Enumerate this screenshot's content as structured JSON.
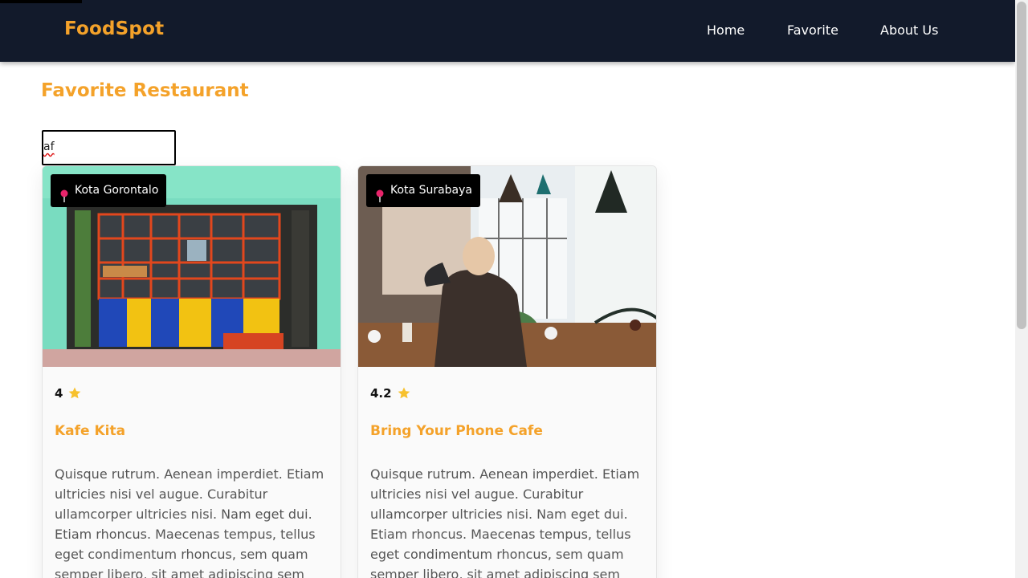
{
  "app": {
    "brand": "FoodSpot"
  },
  "nav": {
    "items": [
      "Home",
      "Favorite",
      "About Us"
    ]
  },
  "page": {
    "title": "Favorite Restaurant"
  },
  "search": {
    "value": "af"
  },
  "restaurants": [
    {
      "city": "Kota Gorontalo",
      "rating": "4",
      "name": "Kafe Kita",
      "description": "Quisque rutrum. Aenean imperdiet. Etiam ultricies nisi vel augue. Curabitur ullamcorper ultricies nisi. Nam eget dui. Etiam rhoncus. Maecenas tempus, tellus eget condimentum rhoncus, sem quam semper libero, sit amet adipiscing sem"
    },
    {
      "city": "Kota Surabaya",
      "rating": "4.2",
      "name": "Bring Your Phone Cafe",
      "description": "Quisque rutrum. Aenean imperdiet. Etiam ultricies nisi vel augue. Curabitur ullamcorper ultricies nisi. Nam eget dui. Etiam rhoncus. Maecenas tempus, tellus eget condimentum rhoncus, sem quam semper libero, sit amet adipiscing sem"
    }
  ],
  "icons": {
    "location": "location-pin-icon",
    "rating": "star-icon"
  },
  "colors": {
    "brand": "#f4a22a",
    "header": "#121a2b",
    "badge": "#000000",
    "star": "#f7c12d"
  }
}
